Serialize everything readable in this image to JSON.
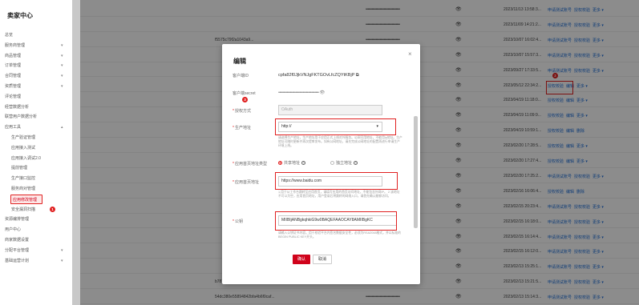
{
  "sidebar": {
    "title": "卖家中心",
    "items": [
      {
        "label": "总览",
        "chev": ""
      },
      {
        "label": "服务商管理",
        "chev": "▾"
      },
      {
        "label": "商品管理",
        "chev": "▾"
      },
      {
        "label": "订单管理",
        "chev": "▾"
      },
      {
        "label": "合同管理",
        "chev": "▾"
      },
      {
        "label": "资质管理",
        "chev": "▾"
      },
      {
        "label": "评论管理",
        "chev": ""
      },
      {
        "label": "经营数据分析",
        "chev": ""
      },
      {
        "label": "联营用户数据分析",
        "chev": ""
      },
      {
        "label": "应用工具",
        "chev": "▴"
      }
    ],
    "sub_items": [
      "生产验证管理",
      "应用接入测试",
      "应用接入调试2.0",
      "提前管理",
      "生产接口监控",
      "服务商对管理",
      "应用修改管理",
      "安全漏洞扫描"
    ],
    "items_after": [
      {
        "label": "资源编排管理",
        "chev": ""
      },
      {
        "label": "用户中心",
        "chev": ""
      },
      {
        "label": "商家数据设置",
        "chev": ""
      },
      {
        "label": "分配平台管理",
        "chev": "▾"
      },
      {
        "label": "基础运营计划",
        "chev": "▾"
      }
    ],
    "badge": "1"
  },
  "table": {
    "rows": [
      {
        "id": "",
        "secret": "••••••••••••••••••••••••••••••••••",
        "time": "2023/11/13 13:58:3...",
        "ops": [
          "申请测试账号",
          "授权校验",
          "更多 ▾"
        ]
      },
      {
        "id": "",
        "secret": "••••••••••••••••••••••••••••••••••",
        "time": "2023/11/09 14:21:2...",
        "ops": [
          "申请测试账号",
          "授权校验",
          "更多 ▾"
        ]
      },
      {
        "id": "f5575c79f2a1043a9...",
        "secret": "••••••••••••••••••••••••••••••••••",
        "time": "2023/10/07 16:02:4...",
        "ops": [
          "申请测试账号",
          "授权校验",
          "更多 ▾"
        ]
      },
      {
        "id": "",
        "secret": "••••••••••••••••••••••••••••••••••",
        "time": "2023/10/07 15:57:3...",
        "ops": [
          "申请测试账号",
          "授权校验",
          "更多 ▾"
        ]
      },
      {
        "id": "",
        "secret": "••••••••••••••••••••••••••••••••••",
        "time": "2023/09/27 17:33:5...",
        "ops": [
          "申请测试账号",
          "授权校验",
          "更多 ▾"
        ]
      },
      {
        "id": "",
        "secret": "••••••••••••••••••••••••••••••••••",
        "time": "2023/05/12 22:34:2...",
        "ops": [
          "授权校验",
          "编辑",
          "更多 ▾"
        ]
      },
      {
        "id": "",
        "secret": "••••••••••••••••••••••••••••••••••",
        "time": "2023/04/19 11:18:0...",
        "ops": [
          "授权校验",
          "编辑",
          "更多 ▾"
        ]
      },
      {
        "id": "",
        "secret": "••••••••••••••••••••••••••••••••••",
        "time": "2023/04/19 11:09:9...",
        "ops": [
          "授权校验",
          "编辑",
          "更多 ▾"
        ]
      },
      {
        "id": "",
        "secret": "••••••••••••••••••••••••••••••••••",
        "time": "2023/04/19 10:59:1...",
        "ops": [
          "授权校验",
          "编辑",
          "删除"
        ]
      },
      {
        "id": "",
        "secret": "••••••••••••••••••••••••••••••••••",
        "time": "2023/02/20 17:28:5...",
        "ops": [
          "授权校验",
          "编辑",
          "更多 ▾"
        ]
      },
      {
        "id": "",
        "secret": "••••••••••••••••••••••••••••••••••",
        "time": "2023/02/20 17:27:4...",
        "ops": [
          "授权校验",
          "编辑",
          "更多 ▾"
        ]
      },
      {
        "id": "",
        "secret": "••••••••••••••••••••••••••••••••••",
        "time": "2023/02/20 17:25:2...",
        "ops": [
          "申请测试账号",
          "授权校验",
          "更多 ▾"
        ]
      },
      {
        "id": "",
        "secret": "••••••••••••••••••••••••••••••••••",
        "time": "2023/02/16 16:06:4...",
        "ops": [
          "授权校验",
          "编辑",
          "删除"
        ]
      },
      {
        "id": "",
        "secret": "••••••••••••••••••••••••••••••••••",
        "time": "2023/02/15 20:23:4...",
        "ops": [
          "申请测试账号",
          "授权校验",
          "更多 ▾"
        ]
      },
      {
        "id": "",
        "secret": "••••••••••••••••••••••••••••••••••",
        "time": "2023/02/15 16:18:0...",
        "ops": [
          "申请测试账号",
          "授权校验",
          "更多 ▾"
        ]
      },
      {
        "id": "",
        "secret": "••••••••••••••••••••••••••••••••••",
        "time": "2023/02/15 16:14:4...",
        "ops": [
          "申请测试账号",
          "授权校验",
          "更多 ▾"
        ]
      },
      {
        "id": "",
        "secret": "••••••••••••••••••••••••••••••••••",
        "time": "2023/02/15 16:12:0...",
        "ops": [
          "申请测试账号",
          "授权校验",
          "更多 ▾"
        ]
      },
      {
        "id": "",
        "secret": "••••••••••••••••••••••••••••••••••",
        "time": "2023/02/13 15:25:1...",
        "ops": [
          "申请测试账号",
          "授权校验",
          "更多 ▾"
        ]
      },
      {
        "id": "b78734ee01fb48ca8461799328f...",
        "secret": "••••••••••••••••••••••••••••••••••",
        "time": "2023/02/13 15:21:5...",
        "ops": [
          "申请测试账号",
          "授权校验",
          "更多 ▾"
        ]
      },
      {
        "id": "54dc380e55894842bfa4b6f0caf...",
        "secret": "••••••••••••••••••••••••••••••••••",
        "time": "2023/02/13 15:14:3...",
        "ops": [
          "申请测试账号",
          "授权校验",
          "更多 ▾"
        ]
      }
    ],
    "badge": "2"
  },
  "modal": {
    "title": "编辑",
    "close": "×",
    "client_id_label": "客户端ID",
    "client_id_value": "cpfa82f0JjkVNJgFKTGOvLfcZQYtKBjP",
    "client_secret_label": "客户端secret",
    "client_secret_value": "••••••••••••••••••••••••••••••••••••••",
    "auth_label": "授权方式",
    "auth_value": "OAuth",
    "prod_addr_label": "生产地址",
    "prod_addr_value": "http://",
    "prod_addr_hint": "请选择生产地址，生产地址用于应用正式上线对外服务。公网可用地址，不能用ip地址。生产地址可随时更新并再次提审发布。如有公网地址，请先完成公网地址的配置再进行申请生产环境上线。",
    "homepage_type_label": "应用首页地址类型",
    "homepage_type_opt1": "共享地址",
    "homepage_type_opt2": "独立地址",
    "homepage_label": "应用首页地址",
    "homepage_value": "https://www.baidu.com",
    "homepage_hint": "1.用于从工作台跳转至应用首页，请填写应用的首页访问地址，不能包含外网IP。 2.该地址不可以为空，应用首页地址，用户登录后将跳转的网络入口，请首先确认能够访问。",
    "pubkey_label": "公钥",
    "pubkey_value": "MIIBIjANBgkqhkiG9w0BAQEFAAOCAY8AMIIBgKC",
    "pubkey_hint": "请输入公钥证书内容，用于校验平台内签名数据安全性，必须为RSA2048格式，并以标准的BEGIN PUBLIC KEY开头。",
    "ok": "确认",
    "cancel": "取消",
    "badge": "3"
  }
}
